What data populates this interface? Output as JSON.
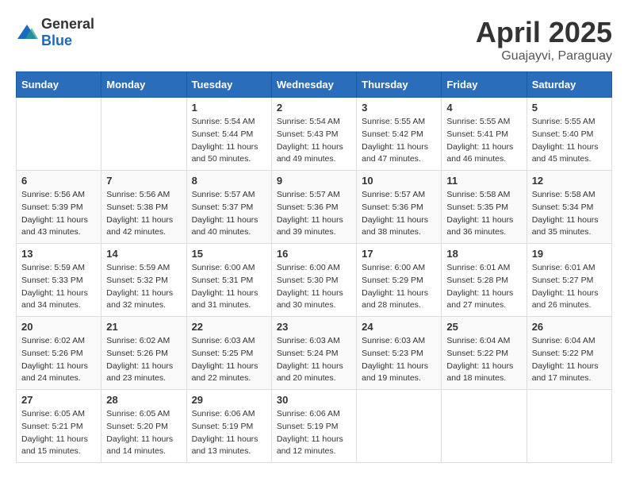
{
  "header": {
    "logo_general": "General",
    "logo_blue": "Blue",
    "month_title": "April 2025",
    "location": "Guajayvi, Paraguay"
  },
  "weekdays": [
    "Sunday",
    "Monday",
    "Tuesday",
    "Wednesday",
    "Thursday",
    "Friday",
    "Saturday"
  ],
  "weeks": [
    [
      {
        "day": "",
        "info": ""
      },
      {
        "day": "",
        "info": ""
      },
      {
        "day": "1",
        "info": "Sunrise: 5:54 AM\nSunset: 5:44 PM\nDaylight: 11 hours and 50 minutes."
      },
      {
        "day": "2",
        "info": "Sunrise: 5:54 AM\nSunset: 5:43 PM\nDaylight: 11 hours and 49 minutes."
      },
      {
        "day": "3",
        "info": "Sunrise: 5:55 AM\nSunset: 5:42 PM\nDaylight: 11 hours and 47 minutes."
      },
      {
        "day": "4",
        "info": "Sunrise: 5:55 AM\nSunset: 5:41 PM\nDaylight: 11 hours and 46 minutes."
      },
      {
        "day": "5",
        "info": "Sunrise: 5:55 AM\nSunset: 5:40 PM\nDaylight: 11 hours and 45 minutes."
      }
    ],
    [
      {
        "day": "6",
        "info": "Sunrise: 5:56 AM\nSunset: 5:39 PM\nDaylight: 11 hours and 43 minutes."
      },
      {
        "day": "7",
        "info": "Sunrise: 5:56 AM\nSunset: 5:38 PM\nDaylight: 11 hours and 42 minutes."
      },
      {
        "day": "8",
        "info": "Sunrise: 5:57 AM\nSunset: 5:37 PM\nDaylight: 11 hours and 40 minutes."
      },
      {
        "day": "9",
        "info": "Sunrise: 5:57 AM\nSunset: 5:36 PM\nDaylight: 11 hours and 39 minutes."
      },
      {
        "day": "10",
        "info": "Sunrise: 5:57 AM\nSunset: 5:36 PM\nDaylight: 11 hours and 38 minutes."
      },
      {
        "day": "11",
        "info": "Sunrise: 5:58 AM\nSunset: 5:35 PM\nDaylight: 11 hours and 36 minutes."
      },
      {
        "day": "12",
        "info": "Sunrise: 5:58 AM\nSunset: 5:34 PM\nDaylight: 11 hours and 35 minutes."
      }
    ],
    [
      {
        "day": "13",
        "info": "Sunrise: 5:59 AM\nSunset: 5:33 PM\nDaylight: 11 hours and 34 minutes."
      },
      {
        "day": "14",
        "info": "Sunrise: 5:59 AM\nSunset: 5:32 PM\nDaylight: 11 hours and 32 minutes."
      },
      {
        "day": "15",
        "info": "Sunrise: 6:00 AM\nSunset: 5:31 PM\nDaylight: 11 hours and 31 minutes."
      },
      {
        "day": "16",
        "info": "Sunrise: 6:00 AM\nSunset: 5:30 PM\nDaylight: 11 hours and 30 minutes."
      },
      {
        "day": "17",
        "info": "Sunrise: 6:00 AM\nSunset: 5:29 PM\nDaylight: 11 hours and 28 minutes."
      },
      {
        "day": "18",
        "info": "Sunrise: 6:01 AM\nSunset: 5:28 PM\nDaylight: 11 hours and 27 minutes."
      },
      {
        "day": "19",
        "info": "Sunrise: 6:01 AM\nSunset: 5:27 PM\nDaylight: 11 hours and 26 minutes."
      }
    ],
    [
      {
        "day": "20",
        "info": "Sunrise: 6:02 AM\nSunset: 5:26 PM\nDaylight: 11 hours and 24 minutes."
      },
      {
        "day": "21",
        "info": "Sunrise: 6:02 AM\nSunset: 5:26 PM\nDaylight: 11 hours and 23 minutes."
      },
      {
        "day": "22",
        "info": "Sunrise: 6:03 AM\nSunset: 5:25 PM\nDaylight: 11 hours and 22 minutes."
      },
      {
        "day": "23",
        "info": "Sunrise: 6:03 AM\nSunset: 5:24 PM\nDaylight: 11 hours and 20 minutes."
      },
      {
        "day": "24",
        "info": "Sunrise: 6:03 AM\nSunset: 5:23 PM\nDaylight: 11 hours and 19 minutes."
      },
      {
        "day": "25",
        "info": "Sunrise: 6:04 AM\nSunset: 5:22 PM\nDaylight: 11 hours and 18 minutes."
      },
      {
        "day": "26",
        "info": "Sunrise: 6:04 AM\nSunset: 5:22 PM\nDaylight: 11 hours and 17 minutes."
      }
    ],
    [
      {
        "day": "27",
        "info": "Sunrise: 6:05 AM\nSunset: 5:21 PM\nDaylight: 11 hours and 15 minutes."
      },
      {
        "day": "28",
        "info": "Sunrise: 6:05 AM\nSunset: 5:20 PM\nDaylight: 11 hours and 14 minutes."
      },
      {
        "day": "29",
        "info": "Sunrise: 6:06 AM\nSunset: 5:19 PM\nDaylight: 11 hours and 13 minutes."
      },
      {
        "day": "30",
        "info": "Sunrise: 6:06 AM\nSunset: 5:19 PM\nDaylight: 11 hours and 12 minutes."
      },
      {
        "day": "",
        "info": ""
      },
      {
        "day": "",
        "info": ""
      },
      {
        "day": "",
        "info": ""
      }
    ]
  ]
}
